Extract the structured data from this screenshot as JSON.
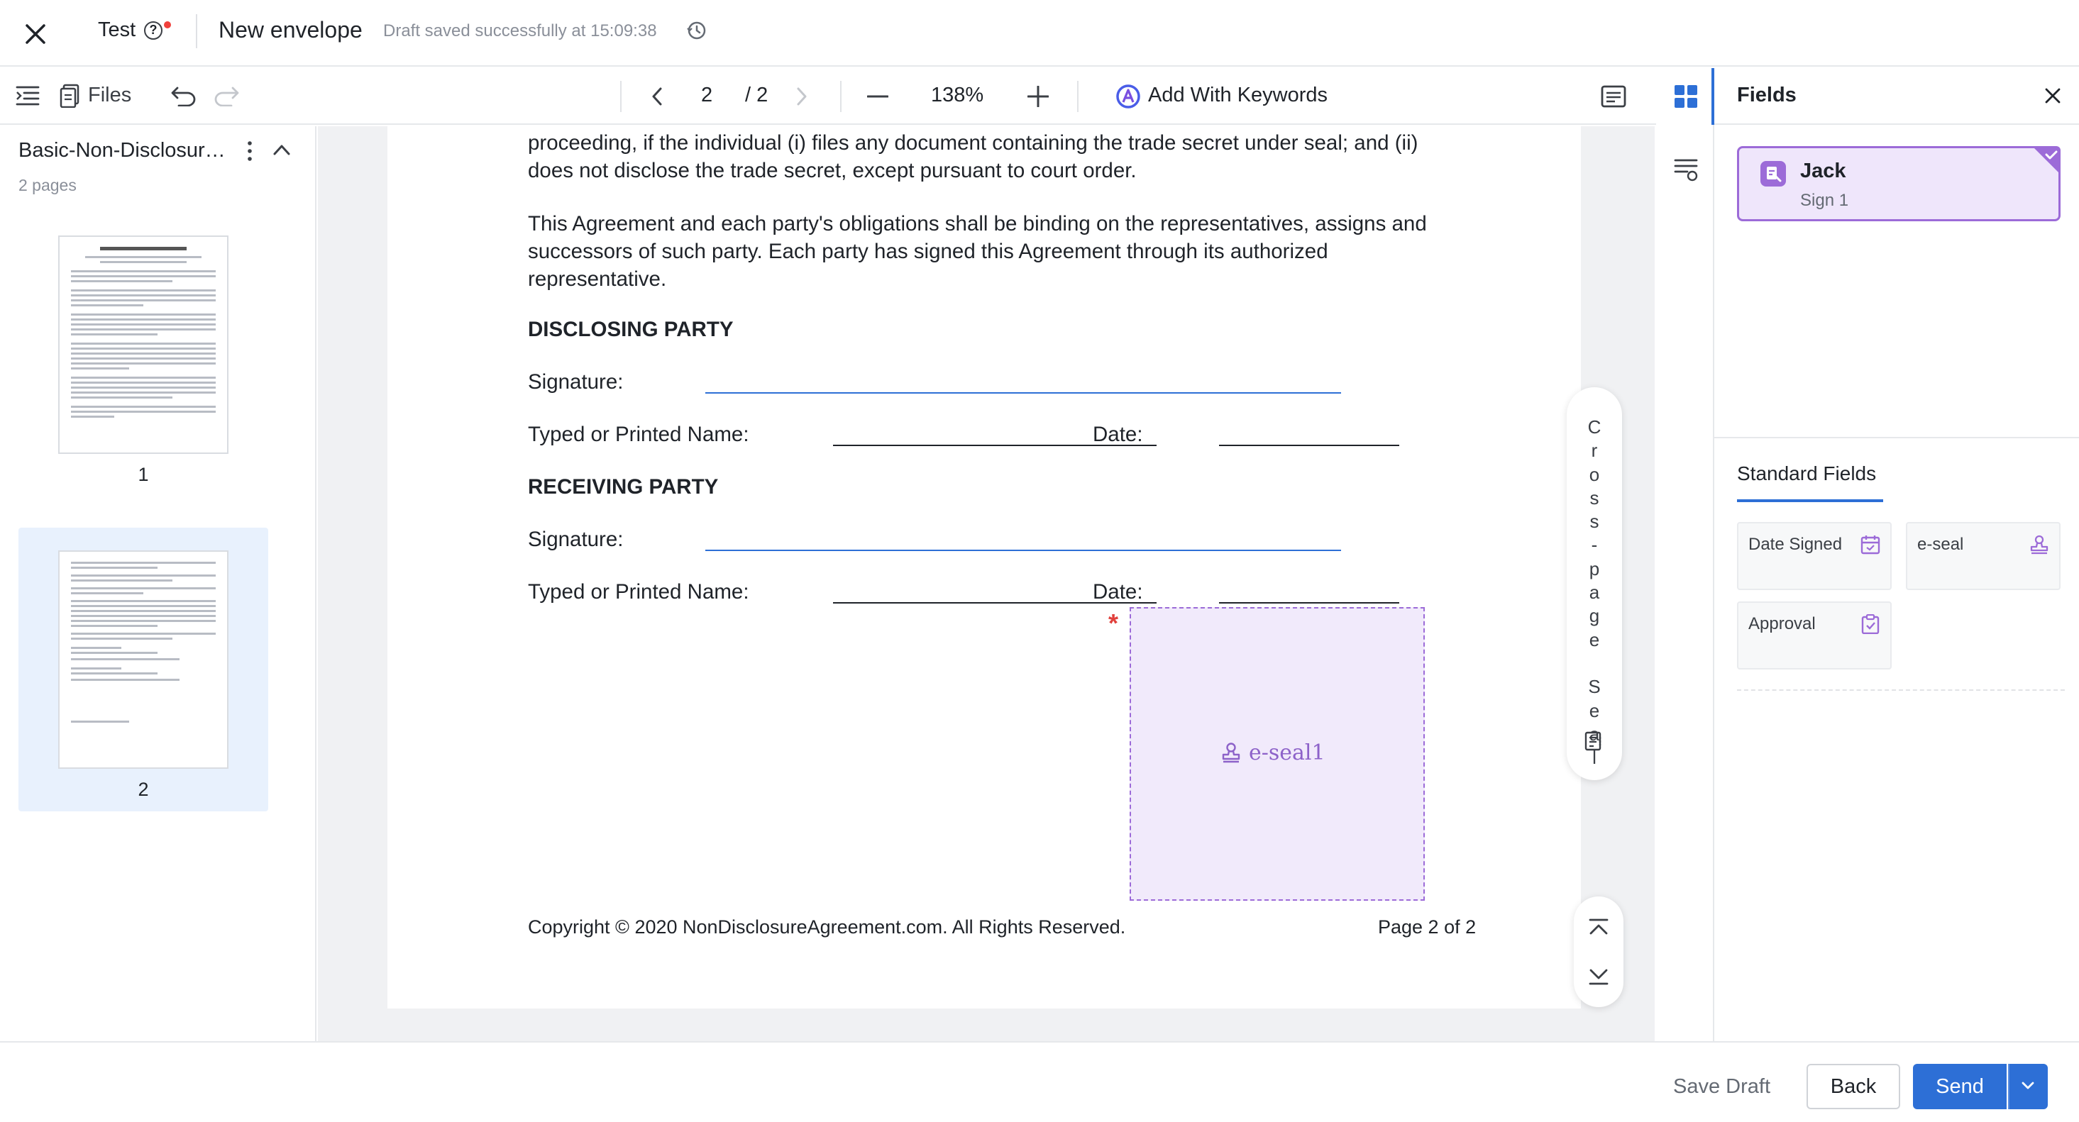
{
  "topbar": {
    "envelope_name": "Test",
    "title": "New envelope",
    "saved_status": "Draft saved successfully at 15:09:38"
  },
  "toolbar": {
    "files_label": "Files",
    "current_page": "2",
    "total_pages": "/ 2",
    "zoom": "138%",
    "keywords_label": "Add With Keywords"
  },
  "sidebar": {
    "document_name": "Basic-Non-Disclosure-Agreement",
    "page_count": "2 pages",
    "thumbnails": [
      {
        "number": "1"
      },
      {
        "number": "2"
      }
    ]
  },
  "document": {
    "para1": "proceeding, if the individual (i) files any document containing the trade secret under seal; and (ii) does not disclose the trade secret, except pursuant to court order.",
    "para2": "This Agreement and each party's obligations shall be binding on the representatives, assigns and successors of such party. Each party has signed this Agreement through its authorized representative.",
    "disclosing_heading": "DISCLOSING PARTY",
    "receiving_heading": "RECEIVING PARTY",
    "signature_label": "Signature:",
    "typed_name_label": "Typed or Printed Name:",
    "date_label": "Date:",
    "copyright": "Copyright © 2020 NonDisclosureAgreement.com. All Rights Reserved.",
    "page_footer": "Page 2 of 2"
  },
  "seal_field": {
    "required_mark": "*",
    "label": "e-seal1"
  },
  "cross_page_seal": {
    "label": [
      "C",
      "r",
      "o",
      "s",
      "s",
      "-",
      "p",
      "a",
      "g",
      "e",
      " ",
      "S",
      "e",
      "a",
      "l"
    ]
  },
  "panel": {
    "title": "Fields",
    "recipient": {
      "name": "Jack",
      "role": "Sign 1",
      "color": "#9c6bd8"
    },
    "standard_tab": "Standard Fields",
    "fields": [
      {
        "label": "Date Signed",
        "icon": "calendar-icon"
      },
      {
        "label": "e-seal",
        "icon": "stamp-icon"
      },
      {
        "label": "Approval",
        "icon": "clipboard-check-icon"
      }
    ]
  },
  "footer": {
    "save_draft": "Save Draft",
    "back": "Back",
    "send": "Send"
  },
  "colors": {
    "accent": "#2d6fd6",
    "recipient": "#9c6bd8",
    "required": "#e0403c"
  }
}
